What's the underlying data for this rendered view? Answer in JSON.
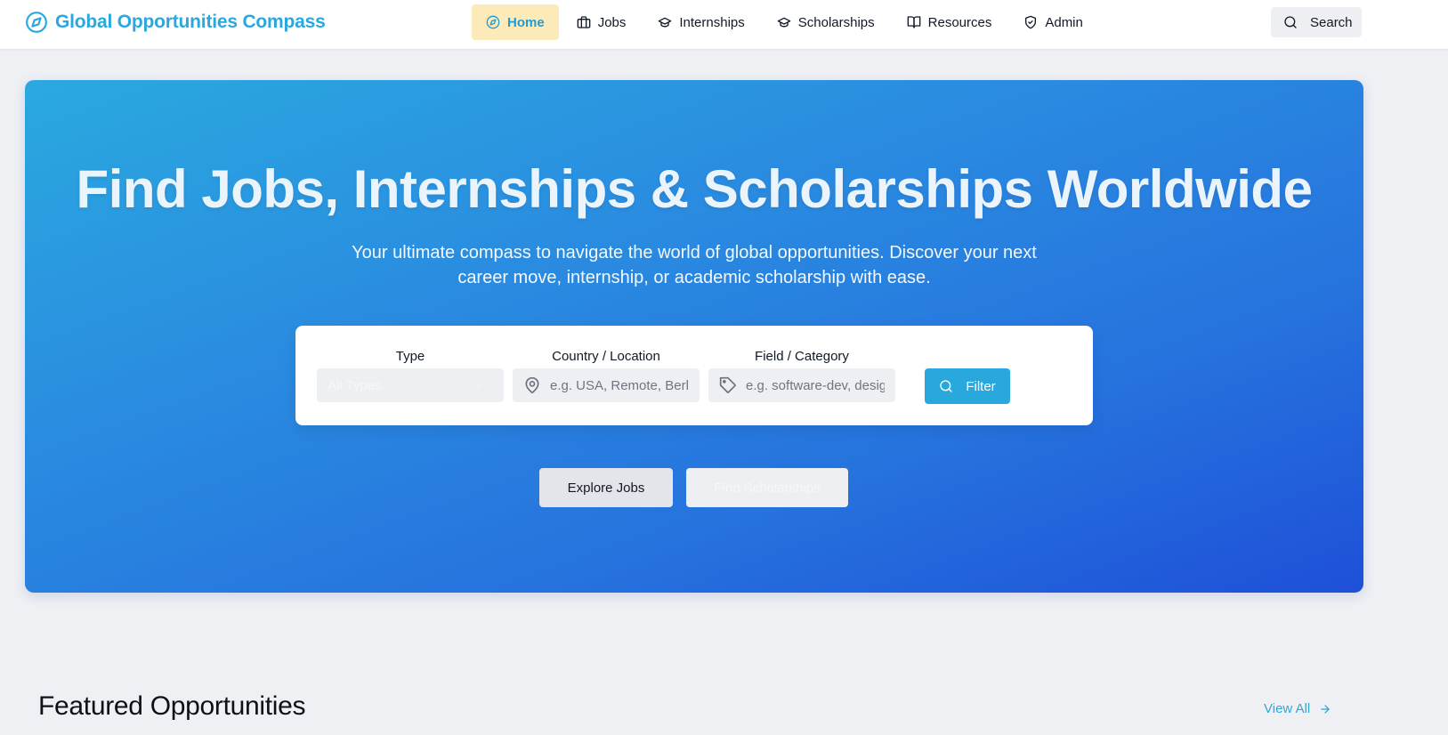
{
  "brand": {
    "name": "Global Opportunities Compass",
    "icon": "compass-icon",
    "color": "#29a8df"
  },
  "nav": {
    "items": [
      {
        "label": "Home",
        "icon": "compass-icon",
        "active": true
      },
      {
        "label": "Jobs",
        "icon": "briefcase-icon",
        "active": false
      },
      {
        "label": "Internships",
        "icon": "graduation-cap-icon",
        "active": false
      },
      {
        "label": "Scholarships",
        "icon": "graduation-cap-icon",
        "active": false
      },
      {
        "label": "Resources",
        "icon": "book-open-icon",
        "active": false
      },
      {
        "label": "Admin",
        "icon": "shield-check-icon",
        "active": false
      }
    ],
    "search_label": "Search"
  },
  "hero": {
    "title": "Find Jobs, Internships & Scholarships Worldwide",
    "subtitle": "Your ultimate compass to navigate the world of global opportunities. Discover your next career move, internship, or academic scholarship with ease.",
    "filter": {
      "type_label": "Type",
      "type_value": "All Types",
      "location_label": "Country / Location",
      "location_placeholder": "e.g. USA, Remote, Berlin",
      "field_label": "Field / Category",
      "field_placeholder": "e.g. software-dev, design",
      "button_label": "Filter"
    },
    "explore_jobs_label": "Explore Jobs",
    "find_scholarships_label": "Find Scholarships",
    "gradient_start": "#2aa9df",
    "gradient_end": "#1e50d8"
  },
  "featured": {
    "title": "Featured Opportunities",
    "view_all_label": "View All"
  }
}
